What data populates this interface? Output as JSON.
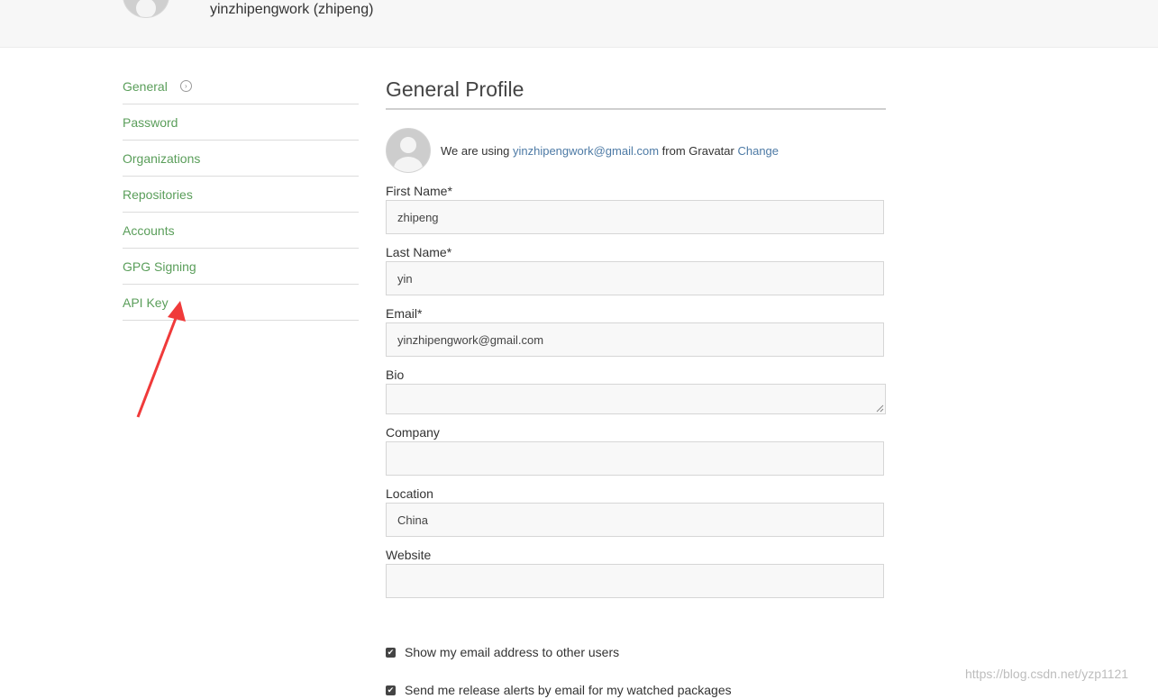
{
  "header": {
    "username": "yinzhipengwork (zhipeng)"
  },
  "sidebar": {
    "items": [
      {
        "label": "General",
        "active": true
      },
      {
        "label": "Password"
      },
      {
        "label": "Organizations"
      },
      {
        "label": "Repositories"
      },
      {
        "label": "Accounts"
      },
      {
        "label": "GPG Signing"
      },
      {
        "label": "API Key"
      }
    ]
  },
  "main": {
    "title": "General Profile",
    "gravatar": {
      "prefix": "We are using",
      "email": "yinzhipengwork@gmail.com",
      "middle": "from Gravatar",
      "change_label": "Change"
    },
    "fields": {
      "first_name": {
        "label": "First Name*",
        "value": "zhipeng"
      },
      "last_name": {
        "label": "Last Name*",
        "value": "yin"
      },
      "email": {
        "label": "Email*",
        "value": "yinzhipengwork@gmail.com"
      },
      "bio": {
        "label": "Bio",
        "value": ""
      },
      "company": {
        "label": "Company",
        "value": ""
      },
      "location": {
        "label": "Location",
        "value": "China"
      },
      "website": {
        "label": "Website",
        "value": ""
      }
    },
    "checkboxes": [
      {
        "label": "Show my email address to other users",
        "checked": true
      },
      {
        "label": "Send me release alerts by email for my watched packages",
        "checked": true
      }
    ]
  },
  "watermark": "https://blog.csdn.net/yzp1121",
  "colors": {
    "nav_link": "#5a9e5a",
    "link": "#4d7aa5",
    "annotation_arrow": "#f03a3a"
  }
}
